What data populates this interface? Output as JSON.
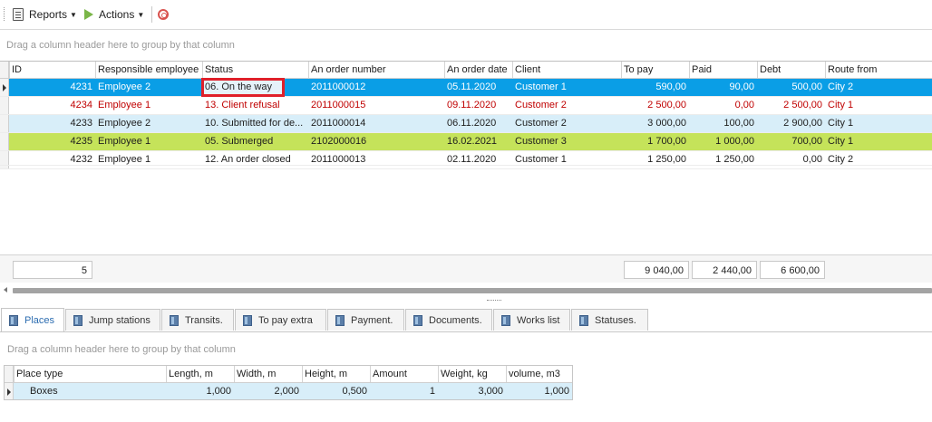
{
  "toolbar": {
    "reports_label": "Reports",
    "actions_label": "Actions"
  },
  "group_panel_text": "Drag a column header here to group by that column",
  "orders": {
    "columns": [
      "ID",
      "Responsible employee",
      "Status",
      "An order number",
      "An order date",
      "Client",
      "To pay",
      "Paid",
      "Debt",
      "Route from"
    ],
    "rows": [
      {
        "id": "4231",
        "employee": "Employee 2",
        "status": "06. On the way",
        "number": "2011000012",
        "date": "05.11.2020",
        "client": "Customer 1",
        "to_pay": "590,00",
        "paid": "90,00",
        "debt": "500,00",
        "route": "City 2"
      },
      {
        "id": "4234",
        "employee": "Employee 1",
        "status": "13. Client refusal",
        "number": "2011000015",
        "date": "09.11.2020",
        "client": "Customer 2",
        "to_pay": "2 500,00",
        "paid": "0,00",
        "debt": "2 500,00",
        "route": "City 1"
      },
      {
        "id": "4233",
        "employee": "Employee 2",
        "status": "10. Submitted for de...",
        "number": "2011000014",
        "date": "06.11.2020",
        "client": "Customer 2",
        "to_pay": "3 000,00",
        "paid": "100,00",
        "debt": "2 900,00",
        "route": "City 1"
      },
      {
        "id": "4235",
        "employee": "Employee 1",
        "status": "05. Submerged",
        "number": "2102000016",
        "date": "16.02.2021",
        "client": "Customer 3",
        "to_pay": "1 700,00",
        "paid": "1 000,00",
        "debt": "700,00",
        "route": "City 1"
      },
      {
        "id": "4232",
        "employee": "Employee 1",
        "status": "12. An order closed",
        "number": "2011000013",
        "date": "02.11.2020",
        "client": "Customer 1",
        "to_pay": "1 250,00",
        "paid": "1 250,00",
        "debt": "0,00",
        "route": "City 2"
      }
    ],
    "footer": {
      "count": "5",
      "to_pay": "9 040,00",
      "paid": "2 440,00",
      "debt": "6 600,00"
    }
  },
  "tabs": [
    "Places",
    "Jump stations",
    "Transits.",
    "To pay extra",
    "Payment.",
    "Documents.",
    "Works list",
    "Statuses."
  ],
  "places": {
    "group_panel_text": "Drag a column header here to group by that column",
    "columns": [
      "Place type",
      "Length, m",
      "Width, m",
      "Height, m",
      "Amount",
      "Weight, kg",
      "volume, m3"
    ],
    "rows": [
      {
        "type": "Boxes",
        "length": "1,000",
        "width": "2,000",
        "height": "0,500",
        "amount": "1",
        "weight": "3,000",
        "volume": "1,000"
      }
    ]
  },
  "colors": {
    "selected_row": "#0a9ee6",
    "refusal_text": "#c00000",
    "alt_row": "#d8eef9",
    "submerged_row": "#c5e35a",
    "focus_border": "#e0202a"
  }
}
